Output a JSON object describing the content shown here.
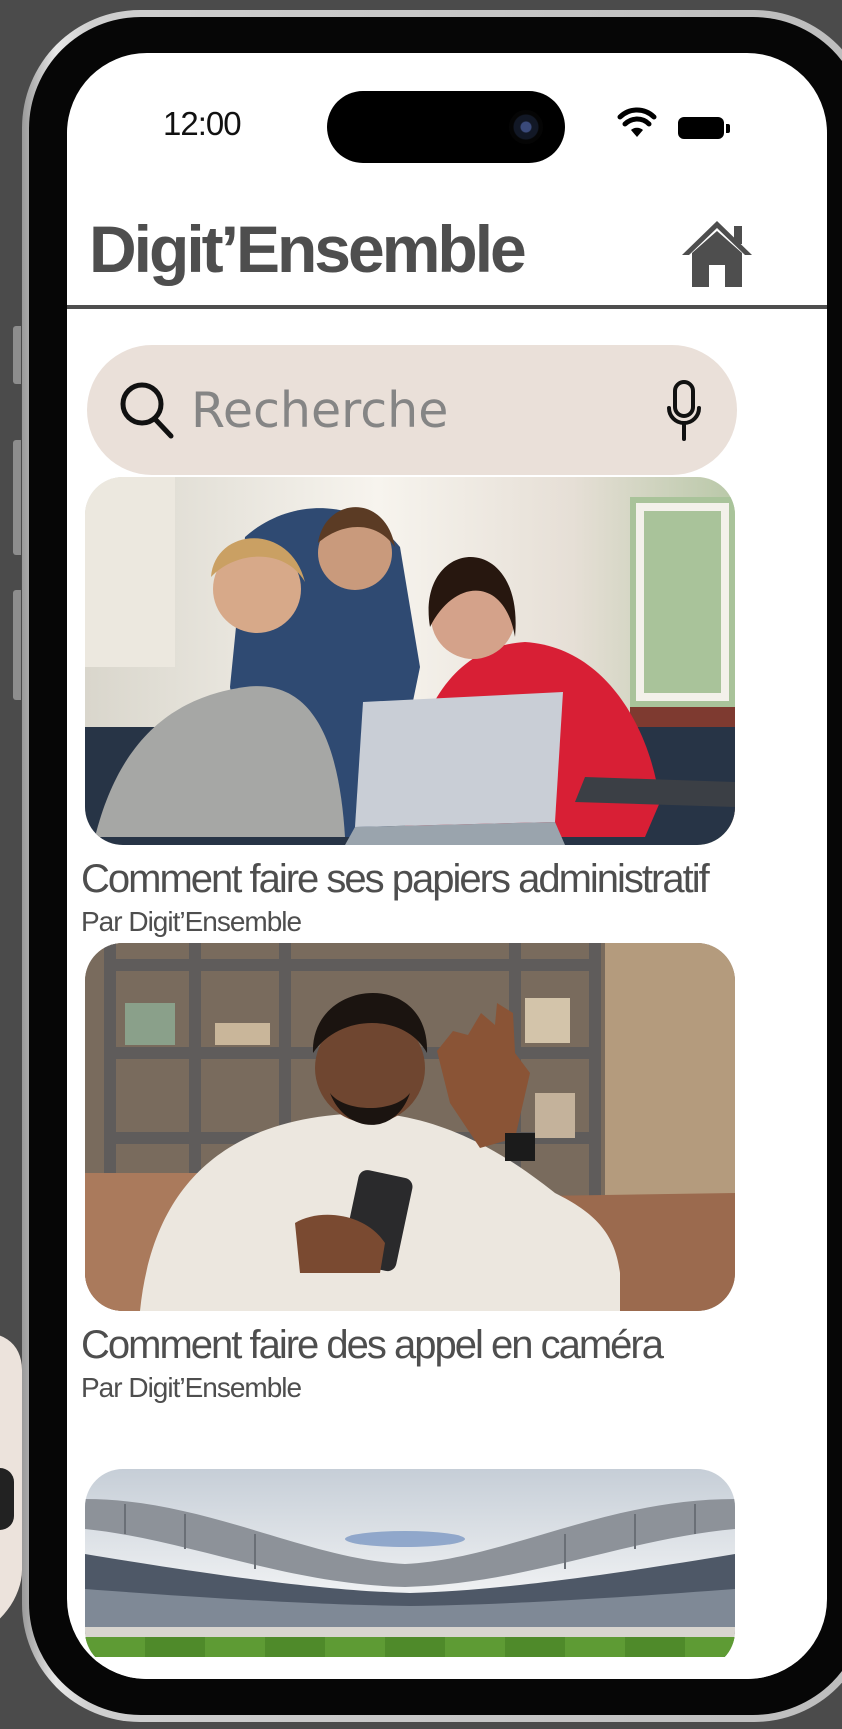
{
  "status_bar": {
    "time": "12:00"
  },
  "header": {
    "app_title": "Digit’Ensemble",
    "home_icon": "home-icon"
  },
  "search": {
    "placeholder": "Recherche",
    "search_icon": "search-icon",
    "mic_icon": "microphone-icon"
  },
  "cards": [
    {
      "title": "Comment faire ses papiers administratif",
      "author": "Par Digit’Ensemble",
      "image": "three-people-using-laptop"
    },
    {
      "title": "Comment faire des appel en caméra",
      "author": "Par Digit’Ensemble",
      "image": "man-waving-at-phone"
    },
    {
      "image": "stadium"
    }
  ],
  "colors": {
    "brand_dark": "#4e4e4e",
    "search_background": "#eae0d9",
    "background": "#ffffff"
  }
}
